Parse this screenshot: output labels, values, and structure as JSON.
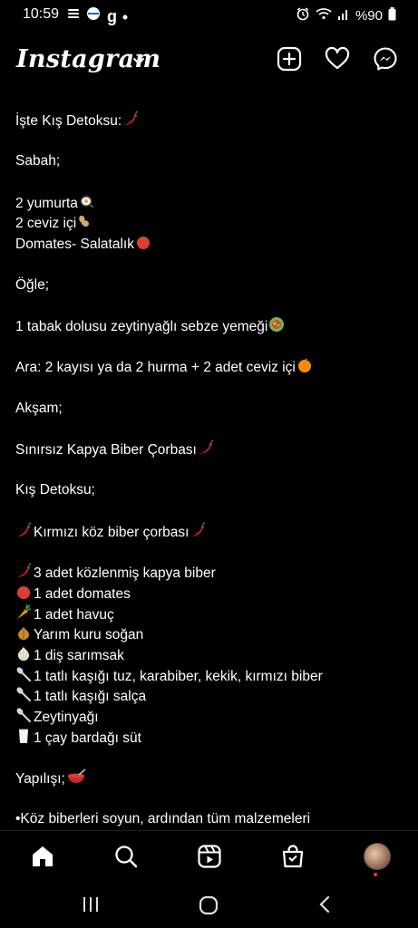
{
  "status_bar": {
    "time": "10:59",
    "battery": "%90",
    "icons": [
      "notification-stack-icon",
      "app-badge-icon",
      "g-app-icon",
      "dot-icon",
      "alarm-icon",
      "wifi-icon",
      "signal-icon",
      "battery-icon"
    ]
  },
  "header": {
    "logo": "Instagram",
    "icons": [
      "chevron-down-icon",
      "new-post-icon",
      "heart-icon",
      "messenger-icon"
    ]
  },
  "post": {
    "lines": [
      {
        "text": "İşte Kış Detoksu:",
        "icon": "chili-pepper-icon",
        "pos": "after"
      },
      {
        "text": ""
      },
      {
        "text": "Sabah;"
      },
      {
        "text": ""
      },
      {
        "text": "2 yumurta",
        "icon": "fried-egg-icon",
        "pos": "after"
      },
      {
        "text": "2 ceviz içi",
        "icon": "peanut-icon",
        "pos": "after"
      },
      {
        "text": "Domates- Salatalık",
        "icon": "tomato-icon",
        "pos": "after"
      },
      {
        "text": ""
      },
      {
        "text": "Öğle;"
      },
      {
        "text": ""
      },
      {
        "text": "1 tabak dolusu zeytinyağlı sebze yemeği",
        "icon": "salad-icon",
        "pos": "after"
      },
      {
        "text": ""
      },
      {
        "text": "Ara: 2 kayısı ya da 2 hurma + 2 adet ceviz içi",
        "icon": "tangerine-icon",
        "pos": "after"
      },
      {
        "text": ""
      },
      {
        "text": "Akşam;"
      },
      {
        "text": ""
      },
      {
        "text": "Sınırsız Kapya Biber Çorbası",
        "icon": "chili-pepper-icon",
        "pos": "after"
      },
      {
        "text": ""
      },
      {
        "text": "Kış Detoksu;"
      },
      {
        "text": ""
      },
      {
        "text": "Kırmızı köz biber çorbası",
        "icon": "chili-pepper-icon",
        "pos": "both"
      },
      {
        "text": ""
      },
      {
        "text": "3 adet közlenmiş kapya biber",
        "icon": "chili-pepper-icon",
        "pos": "before"
      },
      {
        "text": "1 adet domates",
        "icon": "tomato-icon",
        "pos": "before"
      },
      {
        "text": "1 adet havuç",
        "icon": "carrot-icon",
        "pos": "before"
      },
      {
        "text": "Yarım kuru soğan",
        "icon": "onion-icon",
        "pos": "before"
      },
      {
        "text": "1 diş sarımsak",
        "icon": "garlic-icon",
        "pos": "before"
      },
      {
        "text": "1 tatlı kaşığı tuz, karabiber, kekik, kırmızı biber",
        "icon": "spoon-icon",
        "pos": "before"
      },
      {
        "text": "1 tatlı kaşığı salça",
        "icon": "spoon-icon",
        "pos": "before"
      },
      {
        "text": "Zeytinyağı",
        "icon": "spoon-icon",
        "pos": "before"
      },
      {
        "text": "1 çay bardağı süt",
        "icon": "milk-glass-icon",
        "pos": "before"
      },
      {
        "text": ""
      },
      {
        "text": "Yapılışı;",
        "icon": "soup-bowl-icon",
        "pos": "after"
      },
      {
        "text": ""
      },
      {
        "text": "•Köz biberleri soyun, ardından tüm malzemeleri"
      }
    ]
  },
  "tab_bar": {
    "items": [
      "home-icon",
      "search-icon",
      "reels-icon",
      "shop-icon",
      "profile-avatar"
    ]
  },
  "nav_bar": {
    "items": [
      "recent-apps-icon",
      "home-button-icon",
      "back-icon"
    ]
  }
}
